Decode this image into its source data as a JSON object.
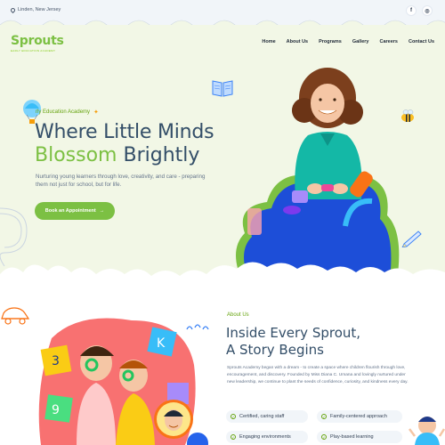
{
  "topbar": {
    "location": "Linden, New Jersey",
    "social": [
      {
        "icon": "facebook-icon",
        "glyph": "f"
      },
      {
        "icon": "instagram-icon",
        "glyph": "◎"
      }
    ]
  },
  "header": {
    "logo_text": "Sprouts",
    "logo_subtitle": "EARLY EDUCATION ACADEMY",
    "nav": [
      "Home",
      "About Us",
      "Programs",
      "Gallery",
      "Careers",
      "Contact Us"
    ]
  },
  "hero": {
    "eyebrow": "rly Education Academy",
    "title_line1": "Where Little Minds",
    "title_highlight": "Blossom",
    "title_rest": "Brightly",
    "description": "Nurturing young learners through love, creativity, and care - preparing them not just for school, but for life.",
    "cta_label": "Book an Appointment",
    "cta_arrow": "→"
  },
  "about": {
    "label": "About Us",
    "title_line1": "Inside Every Sprout,",
    "title_line2": "A Story Begins",
    "description": "Sprouts Academy began with a dream - to create a space where children flourish through love, encouragement, and discovery. Founded by Miss Diana C. Umana and lovingly nurtured under new leadership, we continue to plant the seeds of confidence, curiosity, and kindness every day.",
    "features": [
      "Certified, caring staff",
      "Family-centered approach",
      "Engaging environments",
      "Play-based learning"
    ]
  },
  "colors": {
    "brand_green": "#7cc043",
    "navy": "#334e68",
    "hero_bg": "#f2f7e6"
  }
}
